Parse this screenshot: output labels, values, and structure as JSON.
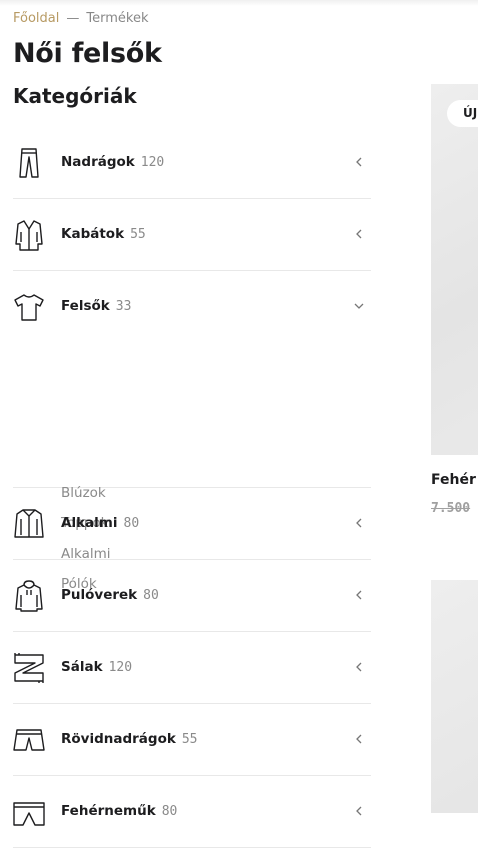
{
  "breadcrumb": {
    "home": "Főoldal",
    "separator": "—",
    "current": "Termékek"
  },
  "page_title": "Női felsők",
  "categories_heading": "Kategóriák",
  "categories": [
    {
      "label": "Nadrágok",
      "count": "120",
      "icon": "pants-icon",
      "arrow": "chevron-left-icon"
    },
    {
      "label": "Kabátok",
      "count": "55",
      "icon": "coat-icon",
      "arrow": "chevron-left-icon"
    },
    {
      "label": "Felsők",
      "count": "33",
      "icon": "tshirt-icon",
      "arrow": "chevron-down-icon",
      "expanded": true,
      "subcategories": [
        "Blúzok",
        "Toppok",
        "Alkalmi",
        "Pólók"
      ]
    },
    {
      "label": "Alkalmi",
      "count": "80",
      "icon": "shirt-icon",
      "arrow": "chevron-left-icon"
    },
    {
      "label": "Pulóverek",
      "count": "80",
      "icon": "hoodie-icon",
      "arrow": "chevron-left-icon"
    },
    {
      "label": "Sálak",
      "count": "120",
      "icon": "scarf-icon",
      "arrow": "chevron-left-icon"
    },
    {
      "label": "Rövidnadrágok",
      "count": "55",
      "icon": "shorts-icon",
      "arrow": "chevron-left-icon"
    },
    {
      "label": "Fehérneműk",
      "count": "80",
      "icon": "underwear-icon",
      "arrow": "chevron-left-icon"
    }
  ],
  "products": [
    {
      "badge": "ÚJ",
      "name": "Fehér",
      "old_price": "7.500"
    }
  ],
  "colors": {
    "breadcrumb_home": "#b79a63",
    "muted": "#8a8a8a",
    "text": "#1d1d1f"
  }
}
